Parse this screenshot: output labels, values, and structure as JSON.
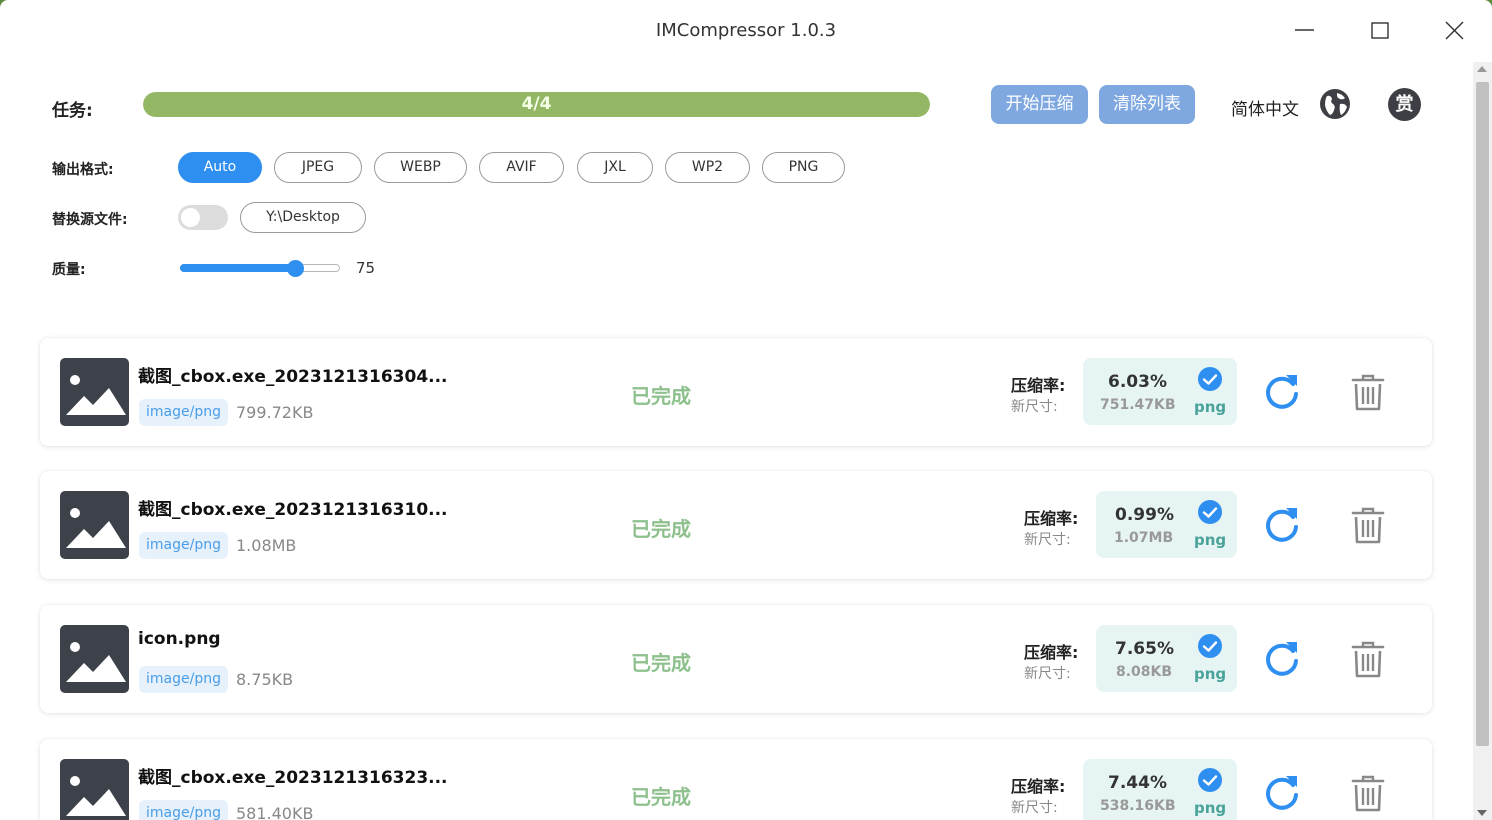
{
  "app": {
    "title": "IMCompressor 1.0.3"
  },
  "task": {
    "label": "任务:",
    "progress_text": "4/4",
    "progress_fraction": 1.0
  },
  "actions": {
    "start_label": "开始压缩",
    "clear_label": "清除列表",
    "language": "简体中文",
    "reward_label": "赏"
  },
  "format": {
    "label": "输出格式:",
    "selected": "Auto",
    "options": [
      "Auto",
      "JPEG",
      "WEBP",
      "AVIF",
      "JXL",
      "WP2",
      "PNG"
    ]
  },
  "replace": {
    "label": "替换源文件:",
    "enabled": false,
    "output_path": "Y:\\Desktop"
  },
  "quality": {
    "label": "质量:",
    "value": "75",
    "min": 0,
    "max": 100
  },
  "list_labels": {
    "rate": "压缩率:",
    "new_size": "新尺寸:"
  },
  "files": [
    {
      "name": "截图_cbox.exe_2023121316304...",
      "mime": "image/png",
      "size": "799.72KB",
      "status": "已完成",
      "ratio": "6.03%",
      "new_size": "751.47KB",
      "ext": "png"
    },
    {
      "name": "截图_cbox.exe_2023121316310...",
      "mime": "image/png",
      "size": "1.08MB",
      "status": "已完成",
      "ratio": "0.99%",
      "new_size": "1.07MB",
      "ext": "png"
    },
    {
      "name": "icon.png",
      "mime": "image/png",
      "size": "8.75KB",
      "status": "已完成",
      "ratio": "7.65%",
      "new_size": "8.08KB",
      "ext": "png"
    },
    {
      "name": "截图_cbox.exe_2023121316323...",
      "mime": "image/png",
      "size": "581.40KB",
      "status": "已完成",
      "ratio": "7.44%",
      "new_size": "538.16KB",
      "ext": "png"
    }
  ],
  "colors": {
    "accent": "#2e8ff0",
    "progress": "#93b764",
    "status_done": "#8dc08c",
    "button": "#7fa8e0"
  },
  "icons": {
    "minimize": "minimize-icon",
    "maximize": "maximize-icon",
    "close": "close-icon",
    "globe": "globe-icon",
    "image": "image-placeholder-icon",
    "check": "check-icon",
    "retry": "retry-icon",
    "delete": "trash-icon"
  }
}
